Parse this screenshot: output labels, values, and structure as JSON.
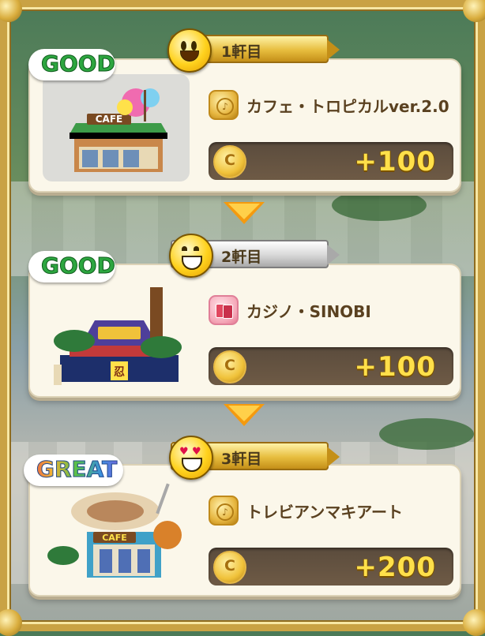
{
  "venues": [
    {
      "order_label": "1軒目",
      "verdict": "GOOD",
      "name": "カフェ・トロピカルver.2.0",
      "reward": "+100",
      "thumb_sign": "CAFE",
      "badge_icon": "cafe-token-icon",
      "face_icon": "smile-face-icon"
    },
    {
      "order_label": "2軒目",
      "verdict": "GOOD",
      "name": "カジノ・SINOBI",
      "reward": "+100",
      "thumb_sign": "忍",
      "badge_icon": "playing-cards-icon",
      "face_icon": "grin-face-icon"
    },
    {
      "order_label": "3軒目",
      "verdict": "GREAT",
      "name": "トレビアンマキアート",
      "reward": "+200",
      "thumb_sign": "CAFE",
      "badge_icon": "cafe-token-icon",
      "face_icon": "heart-eyes-face-icon"
    }
  ],
  "coin_symbol": "C",
  "colors": {
    "reward_text": "#ffe04a",
    "arrow": "#f49a0f",
    "frame_gold": "#c9a244"
  }
}
